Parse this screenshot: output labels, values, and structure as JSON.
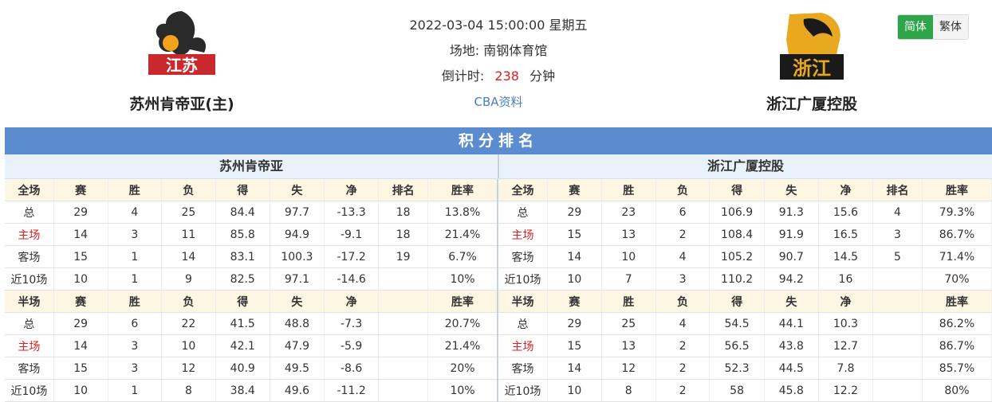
{
  "home": {
    "name": "苏州肯帝亚(主)",
    "short": "苏州肯帝亚",
    "logo_text": "江苏"
  },
  "away": {
    "name": "浙江广厦控股",
    "short": "浙江广厦控股",
    "logo_text": "浙江"
  },
  "match": {
    "datetime": "2022-03-04 15:00:00 星期五",
    "venue_label": "场地:",
    "venue": "南钢体育馆",
    "countdown_label": "倒计时:",
    "countdown_value": "238",
    "countdown_unit": "分钟",
    "cba_link": "CBA资料"
  },
  "lang": {
    "simplified": "简体",
    "traditional": "繁体"
  },
  "section_title": "积分排名",
  "full_header_left": [
    "全场",
    "赛",
    "胜",
    "负",
    "得",
    "失",
    "净",
    "排名",
    "胜率"
  ],
  "half_header": [
    "半场",
    "赛",
    "胜",
    "负",
    "得",
    "失",
    "净",
    "",
    "胜率"
  ],
  "home_full": [
    [
      "总",
      "29",
      "4",
      "25",
      "84.4",
      "97.7",
      "-13.3",
      "18",
      "13.8%"
    ],
    [
      "主场",
      "14",
      "3",
      "11",
      "85.8",
      "94.9",
      "-9.1",
      "18",
      "21.4%"
    ],
    [
      "客场",
      "15",
      "1",
      "14",
      "83.1",
      "100.3",
      "-17.2",
      "19",
      "6.7%"
    ],
    [
      "近10场",
      "10",
      "1",
      "9",
      "82.5",
      "97.1",
      "-14.6",
      "",
      "10%"
    ]
  ],
  "home_half": [
    [
      "总",
      "29",
      "6",
      "22",
      "41.5",
      "48.8",
      "-7.3",
      "",
      "20.7%"
    ],
    [
      "主场",
      "14",
      "3",
      "10",
      "42.1",
      "47.9",
      "-5.9",
      "",
      "21.4%"
    ],
    [
      "客场",
      "15",
      "3",
      "12",
      "40.9",
      "49.5",
      "-8.6",
      "",
      "20%"
    ],
    [
      "近10场",
      "10",
      "1",
      "8",
      "38.4",
      "49.6",
      "-11.2",
      "",
      "10%"
    ]
  ],
  "away_full": [
    [
      "总",
      "29",
      "23",
      "6",
      "106.9",
      "91.3",
      "15.6",
      "4",
      "79.3%"
    ],
    [
      "主场",
      "15",
      "13",
      "2",
      "108.4",
      "91.9",
      "16.5",
      "3",
      "86.7%"
    ],
    [
      "客场",
      "14",
      "10",
      "4",
      "105.2",
      "90.7",
      "14.5",
      "5",
      "71.4%"
    ],
    [
      "近10场",
      "10",
      "7",
      "3",
      "110.2",
      "94.2",
      "16",
      "",
      "70%"
    ]
  ],
  "away_half": [
    [
      "总",
      "29",
      "25",
      "4",
      "54.5",
      "44.1",
      "10.3",
      "",
      "86.2%"
    ],
    [
      "主场",
      "15",
      "13",
      "2",
      "56.5",
      "43.8",
      "12.7",
      "",
      "86.7%"
    ],
    [
      "客场",
      "14",
      "12",
      "2",
      "52.3",
      "44.5",
      "7.8",
      "",
      "85.7%"
    ],
    [
      "近10场",
      "10",
      "8",
      "2",
      "58",
      "45.8",
      "12.2",
      "",
      "80%"
    ]
  ],
  "colors": {
    "accent_blue": "#5b8ccf",
    "red": "#e02020",
    "green": "#2fa54a"
  }
}
